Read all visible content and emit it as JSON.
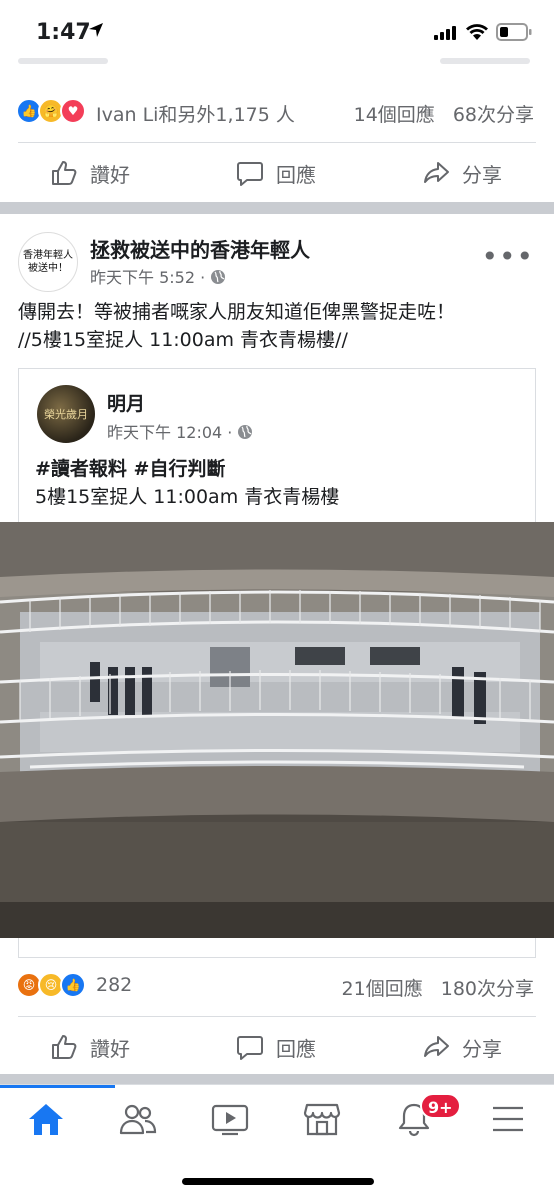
{
  "status": {
    "time": "1:47"
  },
  "prev_post": {
    "reaction_summary": "Ivan Li和另外1,175 人",
    "comments": "14個回應",
    "shares": "68次分享"
  },
  "actions": {
    "like": "讚好",
    "comment": "回應",
    "share": "分享"
  },
  "post": {
    "page_name": "拯救被送中的香港年輕人",
    "avatar_text_line1": "香港年輕人",
    "avatar_text_line2": "被送中！",
    "time": "昨天下午 5:52 ·",
    "text_line1": "傳開去！等被捕者嘅家人朋友知道佢俾黑警捉走咗！",
    "text_line2": "//5樓15室捉人 11:00am 青衣青楊樓//",
    "shared": {
      "name": "明月",
      "avatar_text": "榮光歲月",
      "time": "昨天下午 12:04 ·",
      "tags": "#讀者報料 #自行判斷",
      "text": "5樓15室捉人 11:00am 青衣青楊樓"
    },
    "reaction_count": "282",
    "comments": "21個回應",
    "shares": "180次分享"
  },
  "nav": {
    "items": [
      "home-icon",
      "friends-icon",
      "watch-icon",
      "marketplace-icon",
      "notifications-icon",
      "menu-icon"
    ],
    "notification_badge": "9+"
  },
  "colors": {
    "accent": "#1877f2",
    "badge": "#e41e3f",
    "secondary_text": "#65676b"
  }
}
